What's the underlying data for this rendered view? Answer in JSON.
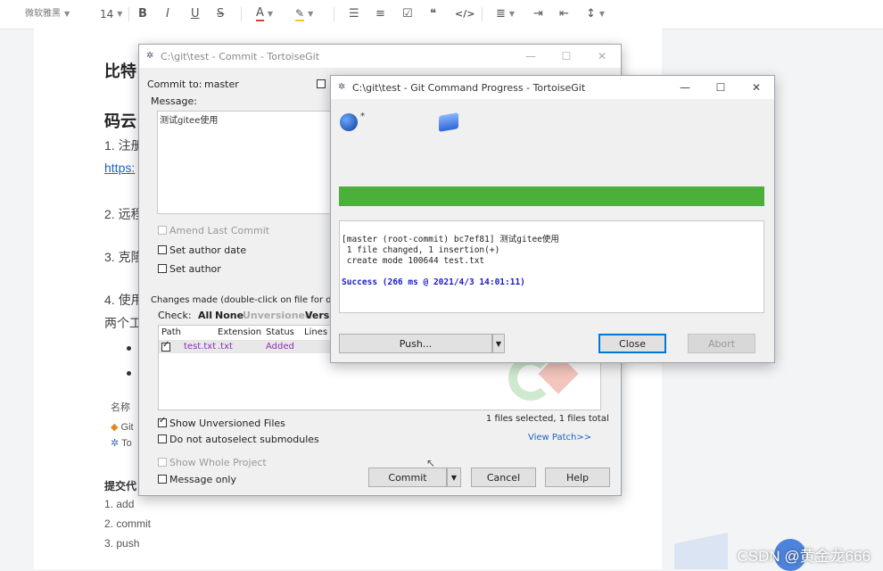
{
  "toolbar": {
    "font_name": "微软雅黑",
    "font_size": "14",
    "bold": "B",
    "italic": "I",
    "underline": "U",
    "strike": "S",
    "font_color": "A",
    "highlight": "✎",
    "list_bullet": "☰",
    "list_number": "≡",
    "todo": "☑",
    "quote": "❝",
    "code": "</>",
    "align": "≣",
    "indent": "⇥",
    "outdent": "⇤",
    "line_height": "↕"
  },
  "doc": {
    "h1": "比特",
    "h2": "码云",
    "item1": "1. 注册",
    "link": "https:",
    "item2": "2. 远程",
    "item3": "3. 克隆",
    "item4": "4. 使用",
    "item4b": "两个工",
    "bullet1": "",
    "bullet2": "",
    "col_name": "名称",
    "git_row": "Git",
    "tortoise_row": "To",
    "commit_heading": "提交代",
    "step1": "1. add",
    "step2": "2. commit",
    "step3": "3. push"
  },
  "commit_window": {
    "title": "C:\\git\\test - Commit - TortoiseGit",
    "commit_to_label": "Commit to:",
    "branch": "master",
    "message_label": "Message:",
    "message": "测试gitee使用",
    "amend": "Amend Last Commit",
    "set_author_date": "Set author date",
    "set_author": "Set author",
    "changes_label": "Changes made (double-click on file for diff",
    "check_label": "Check:",
    "check_all": "All",
    "check_none": "None",
    "check_unversioned": "Unversioned",
    "check_versioned": "Versi",
    "columns": [
      "Path",
      "Extension",
      "Status",
      "Lines a"
    ],
    "file": {
      "path": "test.txt",
      "ext": ".txt",
      "status": "Added"
    },
    "show_unversioned": "Show Unversioned Files",
    "no_autoselect": "Do not autoselect submodules",
    "files_selected": "1 files selected, 1 files total",
    "view_patch": "View Patch>>",
    "show_whole": "Show Whole Project",
    "message_only": "Message only",
    "btn_commit": "Commit",
    "btn_cancel": "Cancel",
    "btn_help": "Help"
  },
  "progress_window": {
    "title": "C:\\git\\test - Git Command Progress - TortoiseGit",
    "progress": 1.0,
    "log_line1": "[master (root-commit) bc7ef81] 测试gitee使用",
    "log_line2": " 1 file changed, 1 insertion(+)",
    "log_line3": " create mode 100644 test.txt",
    "log_success": "Success (266 ms @ 2021/4/3 14:01:11)",
    "btn_push": "Push...",
    "btn_close": "Close",
    "btn_abort": "Abort"
  },
  "watermark": "CSDN @黄金龙666",
  "colors": {
    "progress_green": "#4caf3b",
    "success_blue": "#1a1acc",
    "link_blue": "#1a62c6",
    "added_purple": "#8a2fb5"
  }
}
